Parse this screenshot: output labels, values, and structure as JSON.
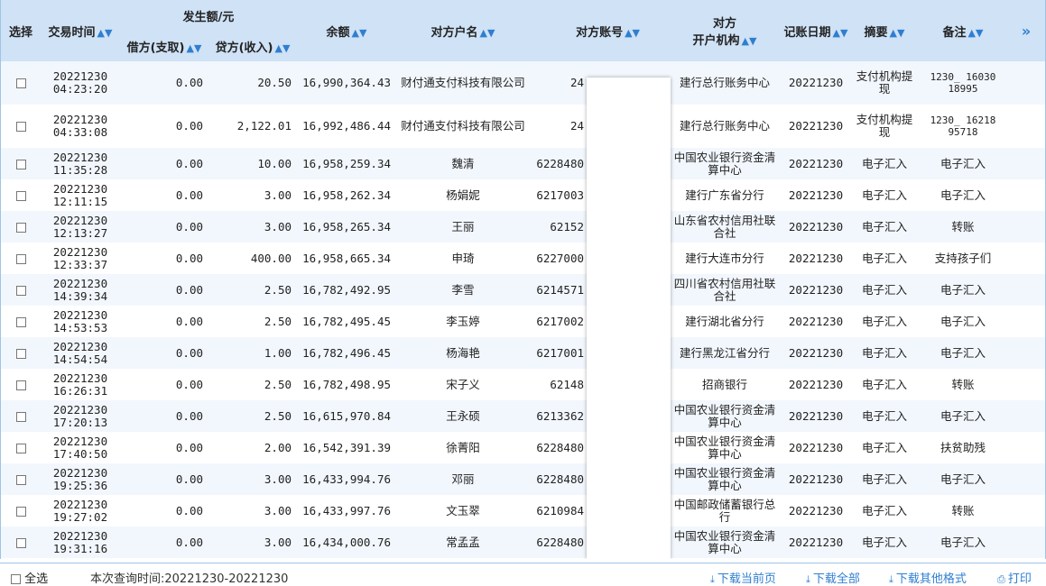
{
  "headers": {
    "select": "选择",
    "trade_time": "交易时间",
    "amount_group": "发生额/元",
    "debit": "借方(支取)",
    "credit": "贷方(收入)",
    "balance": "余额",
    "counterparty_name": "对方户名",
    "counterparty_account": "对方账号",
    "counterparty_bank_l1": "对方",
    "counterparty_bank_l2": "开户机构",
    "post_date": "记账日期",
    "summary": "摘要",
    "remark": "备注",
    "more": "»"
  },
  "rows": [
    {
      "date": "20221230",
      "time": "04:23:20",
      "debit": "0.00",
      "credit": "20.50",
      "balance": "16,990,364.43",
      "name": "财付通支付科技有限公司",
      "account": "24",
      "bank": "建行总行账务中心",
      "post_date": "20221230",
      "summary": "支付机构提现",
      "remark": "1230_ 16030 18995"
    },
    {
      "date": "20221230",
      "time": "04:33:08",
      "debit": "0.00",
      "credit": "2,122.01",
      "balance": "16,992,486.44",
      "name": "财付通支付科技有限公司",
      "account": "24",
      "bank": "建行总行账务中心",
      "post_date": "20221230",
      "summary": "支付机构提现",
      "remark": "1230_ 16218 95718"
    },
    {
      "date": "20221230",
      "time": "11:35:28",
      "debit": "0.00",
      "credit": "10.00",
      "balance": "16,958,259.34",
      "name": "魏清",
      "account": "6228480",
      "bank": "中国农业银行资金清算中心",
      "post_date": "20221230",
      "summary": "电子汇入",
      "remark": "电子汇入"
    },
    {
      "date": "20221230",
      "time": "12:11:15",
      "debit": "0.00",
      "credit": "3.00",
      "balance": "16,958,262.34",
      "name": "杨娟妮",
      "account": "6217003",
      "bank": "建行广东省分行",
      "post_date": "20221230",
      "summary": "电子汇入",
      "remark": "电子汇入"
    },
    {
      "date": "20221230",
      "time": "12:13:27",
      "debit": "0.00",
      "credit": "3.00",
      "balance": "16,958,265.34",
      "name": "王丽",
      "account": "62152",
      "bank": "山东省农村信用社联合社",
      "post_date": "20221230",
      "summary": "电子汇入",
      "remark": "转账"
    },
    {
      "date": "20221230",
      "time": "12:33:37",
      "debit": "0.00",
      "credit": "400.00",
      "balance": "16,958,665.34",
      "name": "申琦",
      "account": "6227000",
      "bank": "建行大连市分行",
      "post_date": "20221230",
      "summary": "电子汇入",
      "remark": "支持孩子们"
    },
    {
      "date": "20221230",
      "time": "14:39:34",
      "debit": "0.00",
      "credit": "2.50",
      "balance": "16,782,492.95",
      "name": "李雪",
      "account": "6214571",
      "bank": "四川省农村信用社联合社",
      "post_date": "20221230",
      "summary": "电子汇入",
      "remark": "电子汇入"
    },
    {
      "date": "20221230",
      "time": "14:53:53",
      "debit": "0.00",
      "credit": "2.50",
      "balance": "16,782,495.45",
      "name": "李玉婷",
      "account": "6217002",
      "bank": "建行湖北省分行",
      "post_date": "20221230",
      "summary": "电子汇入",
      "remark": "电子汇入"
    },
    {
      "date": "20221230",
      "time": "14:54:54",
      "debit": "0.00",
      "credit": "1.00",
      "balance": "16,782,496.45",
      "name": "杨海艳",
      "account": "6217001",
      "bank": "建行黑龙江省分行",
      "post_date": "20221230",
      "summary": "电子汇入",
      "remark": "电子汇入"
    },
    {
      "date": "20221230",
      "time": "16:26:31",
      "debit": "0.00",
      "credit": "2.50",
      "balance": "16,782,498.95",
      "name": "宋子义",
      "account": "62148",
      "bank": "招商银行",
      "post_date": "20221230",
      "summary": "电子汇入",
      "remark": "转账"
    },
    {
      "date": "20221230",
      "time": "17:20:13",
      "debit": "0.00",
      "credit": "2.50",
      "balance": "16,615,970.84",
      "name": "王永硕",
      "account": "6213362",
      "bank": "中国农业银行资金清算中心",
      "post_date": "20221230",
      "summary": "电子汇入",
      "remark": "电子汇入"
    },
    {
      "date": "20221230",
      "time": "17:40:50",
      "debit": "0.00",
      "credit": "2.00",
      "balance": "16,542,391.39",
      "name": "徐菁阳",
      "account": "6228480",
      "bank": "中国农业银行资金清算中心",
      "post_date": "20221230",
      "summary": "电子汇入",
      "remark": "扶贫助残"
    },
    {
      "date": "20221230",
      "time": "19:25:36",
      "debit": "0.00",
      "credit": "3.00",
      "balance": "16,433,994.76",
      "name": "邓丽",
      "account": "6228480",
      "bank": "中国农业银行资金清算中心",
      "post_date": "20221230",
      "summary": "电子汇入",
      "remark": "电子汇入"
    },
    {
      "date": "20221230",
      "time": "19:27:02",
      "debit": "0.00",
      "credit": "3.00",
      "balance": "16,433,997.76",
      "name": "文玉翠",
      "account": "6210984",
      "bank": "中国邮政储蓄银行总行",
      "post_date": "20221230",
      "summary": "电子汇入",
      "remark": "转账"
    },
    {
      "date": "20221230",
      "time": "19:31:16",
      "debit": "0.00",
      "credit": "3.00",
      "balance": "16,434,000.76",
      "name": "常孟孟",
      "account": "6228480",
      "bank": "中国农业银行资金清算中心",
      "post_date": "20221230",
      "summary": "电子汇入",
      "remark": "电子汇入"
    }
  ],
  "footer": {
    "select_all": "全选",
    "query_time": "本次查询时间:20221230-20221230",
    "download_current": "下载当前页",
    "download_all": "下载全部",
    "download_other": "下载其他格式",
    "print": "打印"
  }
}
